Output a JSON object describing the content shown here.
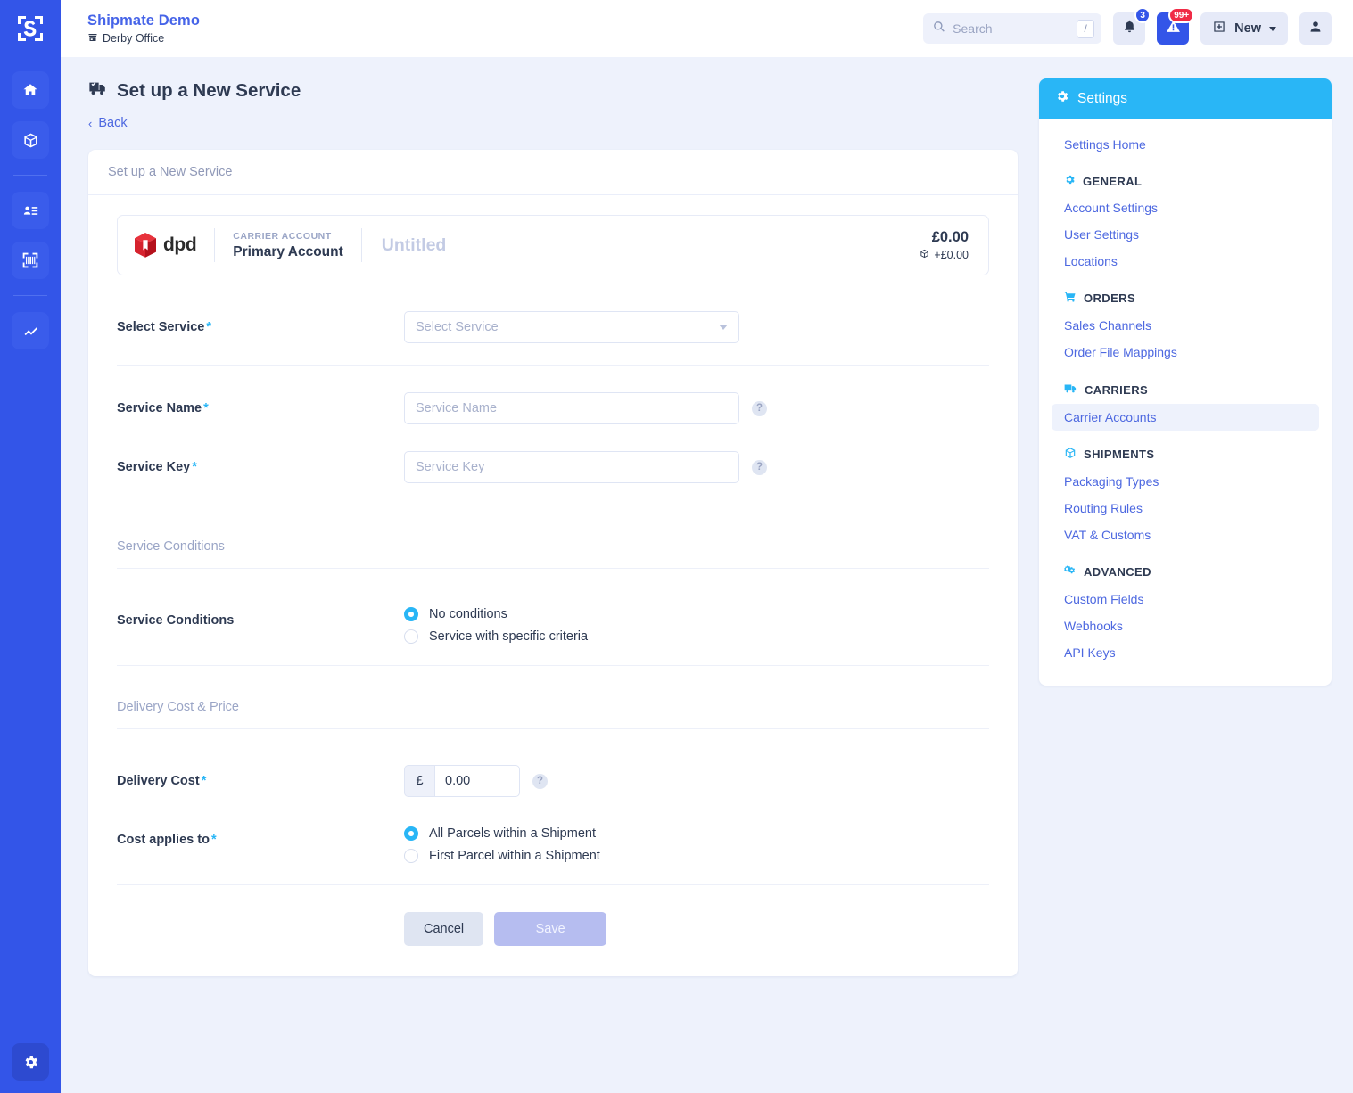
{
  "brand": {
    "title": "Shipmate Demo",
    "office": "Derby Office",
    "office_icon": "store-icon",
    "logo_icon": "shipmate-s-logo"
  },
  "topbar": {
    "search_placeholder": "Search",
    "search_shortcut": "/",
    "search_icon": "search-icon",
    "notifications": {
      "icon": "bell-icon",
      "badge": "3"
    },
    "alerts": {
      "icon": "warning-triangle-icon",
      "badge": "99+"
    },
    "new_button": {
      "label": "New",
      "icon": "plus-square-icon",
      "caret": "chevron-down-icon"
    },
    "account": {
      "icon": "user-icon"
    }
  },
  "rail": {
    "items": [
      {
        "name": "home-icon"
      },
      {
        "name": "package-icon"
      },
      {
        "name": "address-card-icon"
      },
      {
        "name": "barcode-scan-icon"
      },
      {
        "name": "analytics-line-icon"
      }
    ],
    "bottom": {
      "name": "gear-icon"
    }
  },
  "page": {
    "title": "Set up a New Service",
    "title_icon": "delivery-truck-icon",
    "back_label": "Back",
    "back_icon": "chevron-left-icon",
    "card_header": "Set up a New Service"
  },
  "carrier": {
    "logo_word": "dpd",
    "logo_icon": "dpd-cube-logo",
    "account_label": "CARRIER ACCOUNT",
    "account_value": "Primary Account",
    "service_name_placeholder": "Untitled",
    "price_main": "£0.00",
    "price_sub": "+£0.00",
    "price_sub_icon": "package-icon"
  },
  "form": {
    "select_service": {
      "label": "Select Service",
      "required": "*",
      "value": "",
      "placeholder": "Select Service",
      "caret_icon": "chevron-down-icon"
    },
    "service_name": {
      "label": "Service Name",
      "required": "*",
      "value": "",
      "placeholder": "Service Name",
      "help_icon": "question-mark-icon",
      "help_glyph": "?"
    },
    "service_key": {
      "label": "Service Key",
      "required": "*",
      "value": "",
      "placeholder": "Service Key",
      "help_icon": "question-mark-icon",
      "help_glyph": "?"
    },
    "service_conditions_section": "Service Conditions",
    "service_conditions": {
      "label": "Service Conditions",
      "options": [
        {
          "label": "No conditions",
          "selected": true
        },
        {
          "label": "Service with specific criteria",
          "selected": false
        }
      ]
    },
    "delivery_section": "Delivery Cost & Price",
    "delivery_cost": {
      "label": "Delivery Cost",
      "required": "*",
      "currency": "£",
      "value": "0.00",
      "help_glyph": "?"
    },
    "cost_applies_to": {
      "label": "Cost applies to",
      "required": "*",
      "options": [
        {
          "label": "All Parcels within a Shipment",
          "selected": true
        },
        {
          "label": "First Parcel within a Shipment",
          "selected": false
        }
      ]
    },
    "cancel_label": "Cancel",
    "save_label": "Save"
  },
  "settings": {
    "header": "Settings",
    "header_icon": "gear-icon",
    "home_link": "Settings Home",
    "groups": [
      {
        "title": "GENERAL",
        "icon": "gear-icon",
        "links": [
          {
            "label": "Account Settings",
            "active": false
          },
          {
            "label": "User Settings",
            "active": false
          },
          {
            "label": "Locations",
            "active": false
          }
        ]
      },
      {
        "title": "ORDERS",
        "icon": "cart-icon",
        "links": [
          {
            "label": "Sales Channels",
            "active": false
          },
          {
            "label": "Order File Mappings",
            "active": false
          }
        ]
      },
      {
        "title": "CARRIERS",
        "icon": "truck-icon",
        "links": [
          {
            "label": "Carrier Accounts",
            "active": true
          }
        ]
      },
      {
        "title": "SHIPMENTS",
        "icon": "package-icon",
        "links": [
          {
            "label": "Packaging Types",
            "active": false
          },
          {
            "label": "Routing Rules",
            "active": false
          },
          {
            "label": "VAT & Customs",
            "active": false
          }
        ]
      },
      {
        "title": "ADVANCED",
        "icon": "gears-icon",
        "links": [
          {
            "label": "Custom Fields",
            "active": false
          },
          {
            "label": "Webhooks",
            "active": false
          },
          {
            "label": "API Keys",
            "active": false
          }
        ]
      }
    ]
  },
  "colors": {
    "rail": "#3355e8",
    "brand_blue": "#4664e8",
    "accent_cyan": "#29b6f6",
    "link": "#4d68e0",
    "text_dark": "#2e3a52",
    "muted": "#9aa5c6",
    "danger_red": "#f02b46",
    "dpd_red": "#d6232e",
    "page_bg": "#eef2fc"
  }
}
